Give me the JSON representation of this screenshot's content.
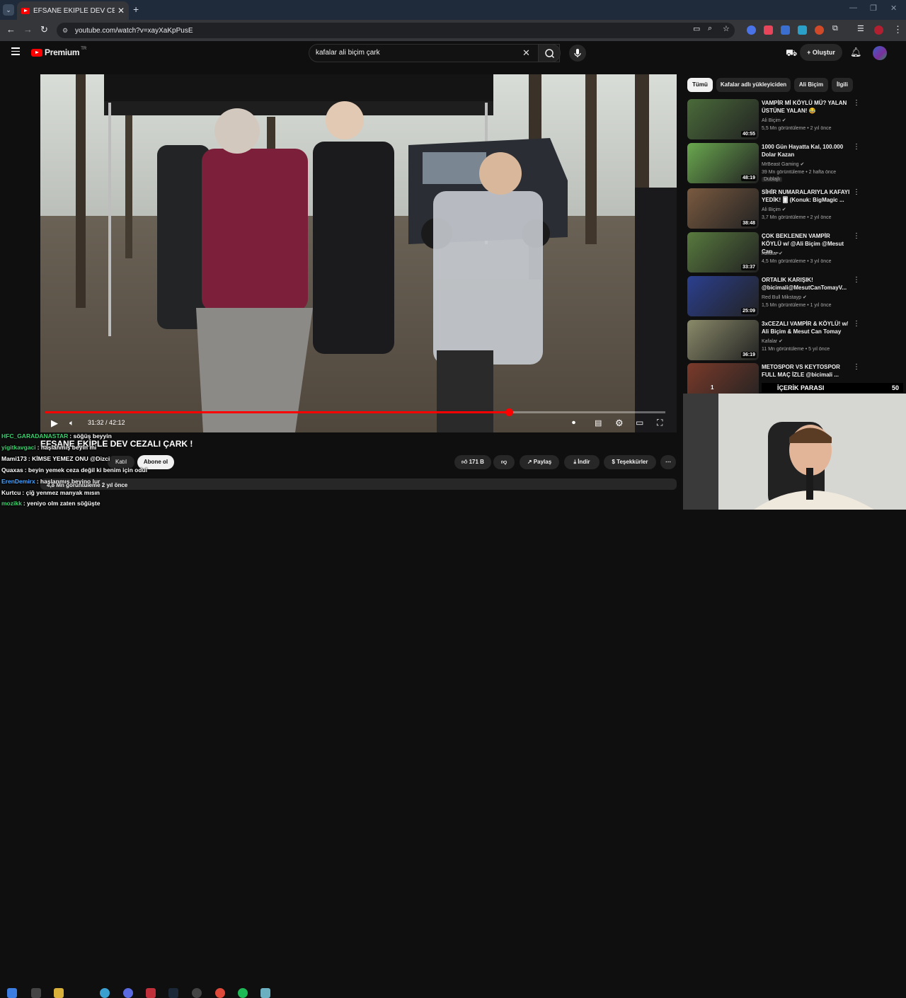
{
  "browser": {
    "tab_title": "EFSANE EKİPLE DEV CEZALI ÇARK",
    "url": "youtube.com/watch?v=xayXaKpPusE"
  },
  "header": {
    "logo_text": "Premium",
    "logo_country": "TR",
    "search_value": "kafalar ali biçim çark",
    "create_label": "Oluştur"
  },
  "player": {
    "time": "31:32 / 42:12",
    "progress": 0.7474
  },
  "video": {
    "title": "EFSANE EKİPLE DEV CEZALI ÇARK !",
    "join_label": "Katıl",
    "subscribe_label": "Abone ol",
    "likes": "171 B",
    "share_label": "Paylaş",
    "download_label": "İndir",
    "thanks_label": "Teşekkürler",
    "views_ago": "4,8 Mn görüntüleme  2 yıl önce"
  },
  "chat": [
    {
      "name": "HFC_GARADANASTAR",
      "msg": "söğüş beyyin",
      "color": "#3cd070"
    },
    {
      "name": "yigitkavgaci",
      "msg": "haşlanmış beyin mi",
      "color": "#3cd070"
    },
    {
      "name": "Mami173",
      "msg": "KİMSE YEMEZ ONU @Dizci",
      "color": "#ffffff"
    },
    {
      "name": "Quaxas",
      "msg": "beyin yemek ceza değil ki benim için odul",
      "color": "#ffffff"
    },
    {
      "name": "ErenDemirx",
      "msg": "haşlanmış beyino lur",
      "color": "#4aa3ff"
    },
    {
      "name": "Kurtcu",
      "msg": "çiğ yenmez manyak mısın",
      "color": "#ffffff"
    },
    {
      "name": "mozikk",
      "msg": "yeniyo olm zaten söğüşte",
      "color": "#3cd070"
    }
  ],
  "chips": [
    "Tümü",
    "Kafalar adlı yükleyiciden",
    "Ali Biçim",
    "İlgili"
  ],
  "recommendations": [
    {
      "title": "VAMPİR Mİ KÖYLÜ MÜ? YALAN ÜSTÜNE YALAN! 😂",
      "channel": "Ali Biçim ✔",
      "meta": "5,5 Mn görüntüleme  •  2 yıl önce",
      "duration": "40:55",
      "thumb_color": "#4a6b3a"
    },
    {
      "title": "1000 Gün Hayatta Kal, 100.000 Dolar Kazan",
      "channel": "MrBeast Gaming ✔",
      "meta": "39 Mn görüntüleme  •  2 hafta önce",
      "duration": "48:19",
      "badge": "Dublajlı",
      "thumb_color": "#6aa84f"
    },
    {
      "title": "SİHİR NUMARALARIYLA KAFAYI YEDİK! 🂠 (Konuk: BigMagic ...",
      "channel": "Ali Biçim ✔",
      "meta": "3,7 Mn görüntüleme  •  2 yıl önce",
      "duration": "38:48",
      "thumb_color": "#7a5a40"
    },
    {
      "title": "ÇOK BEKLENEN VAMPİR KÖYLÜ w/ @Ali Biçim @Mesut Can ...",
      "channel": "Kafalar ✔",
      "meta": "4,5 Mn görüntüleme  •  3 yıl önce",
      "duration": "33:37",
      "thumb_color": "#587a3e"
    },
    {
      "title": "ORTALIK KARIŞIK! @bicimali@MesutCanTomayV...",
      "channel": "Red Bull Mikstayp ✔",
      "meta": "1,5 Mn görüntüleme  •  1 yıl önce",
      "duration": "25:09",
      "thumb_color": "#2b3f8f"
    },
    {
      "title": "3xCEZALI VAMPİR & KÖYLÜ! w/ Ali Biçim & Mesut Can Tomay",
      "channel": "Kafalar ✔",
      "meta": "11 Mn görüntüleme  •  5 yıl önce",
      "duration": "36:19",
      "thumb_color": "#8a8a6a"
    },
    {
      "title": "METOSPOR VS KEYTOSPOR FULL MAÇ İZLE @bicimali ...",
      "channel": "",
      "meta": "",
      "duration": "",
      "thumb_color": "#7a3a2a"
    }
  ],
  "overlay_banner": {
    "label": "İÇERİK PARASI",
    "value": "50",
    "rank": "1"
  }
}
